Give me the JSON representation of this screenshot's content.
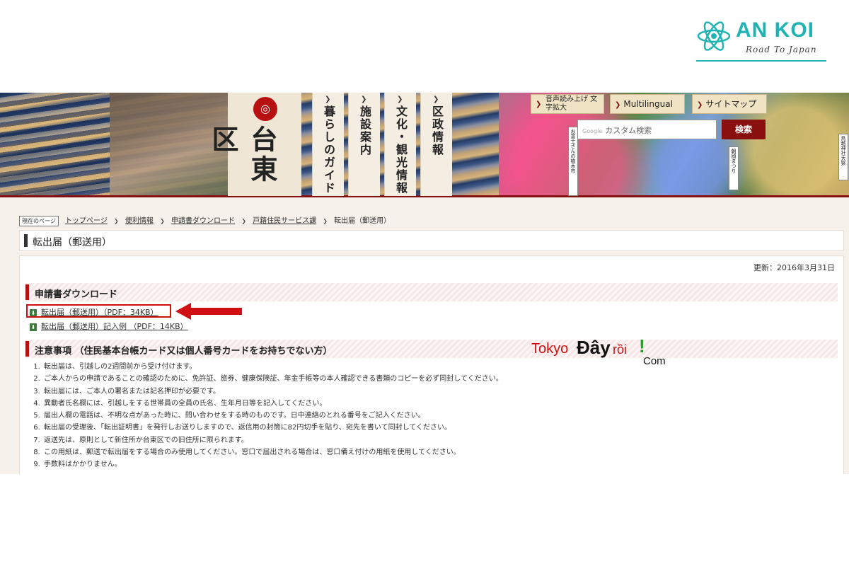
{
  "logo": {
    "title": "AN KOI",
    "subtitle": "Road To Japan"
  },
  "header": {
    "ward_name": "台東区",
    "nav_tabs": [
      {
        "label": "暮らしのガイド"
      },
      {
        "label": "施設案内"
      },
      {
        "label": "文化・観光情報"
      },
      {
        "label": "区政情報"
      }
    ],
    "top_buttons": {
      "speech": "音声読み上げ 文字拡大",
      "multilingual": "Multilingual",
      "sitemap": "サイトマップ"
    },
    "search": {
      "placeholder": "カスタム検索",
      "google_label": "Google",
      "button": "検索"
    },
    "signs": [
      "お富士さんの植木市",
      "朝顔まつり",
      "鳥越神社大祭"
    ]
  },
  "breadcrumb": {
    "here_label": "現在のページ",
    "items": [
      "トップページ",
      "便利情報",
      "申請書ダウンロード",
      "戸籍住民サービス課"
    ],
    "current": "転出届（郵送用）"
  },
  "page_title": "転出届（郵送用）",
  "updated": "更新：2016年3月31日",
  "download_section": {
    "heading": "申請書ダウンロード",
    "files": [
      {
        "label": "転出届（郵送用）（PDF：34KB）"
      },
      {
        "label": "転出届（郵送用）記入例 （PDF：14KB）"
      }
    ]
  },
  "notes_section": {
    "heading": "注意事項 （住民基本台帳カード又は個人番号カードをお持ちでない方）",
    "items": [
      "転出届は、引越しの2週間前から受け付けます。",
      "ご本人からの申請であることの確認のために、免許証、旅券、健康保険証、年金手帳等の本人確認できる書類のコピーを必ず同封してください。",
      "転出届には、ご本人の署名または記名押印が必要です。",
      "異動者氏名欄には、引越しをする世帯員の全員の氏名、生年月日等を記入してください。",
      "届出人欄の電話は、不明な点があった時に、問い合わせをする時のものです。日中連絡のとれる番号をご記入ください。",
      "転出届の受理後、「転出証明書」を発行しお送りしますので、返信用の封筒に82円切手を貼り、宛先を書いて同封してください。",
      "返送先は、原則として新住所か台東区での旧住所に限られます。",
      "この用紙は、郵送で転出届をする場合のみ使用してください。窓口で届出される場合は、窓口備え付けの用紙を使用してください。",
      "手数料はかかりません。"
    ]
  },
  "watermark": {
    "tokyo": "Tokyo",
    "day": "Đây",
    "roi": "rồi",
    "bang": "!",
    "com": "Com"
  },
  "colors": {
    "accent_red": "#b81010",
    "teal": "#1fb3b3",
    "highlight": "#d01010"
  }
}
